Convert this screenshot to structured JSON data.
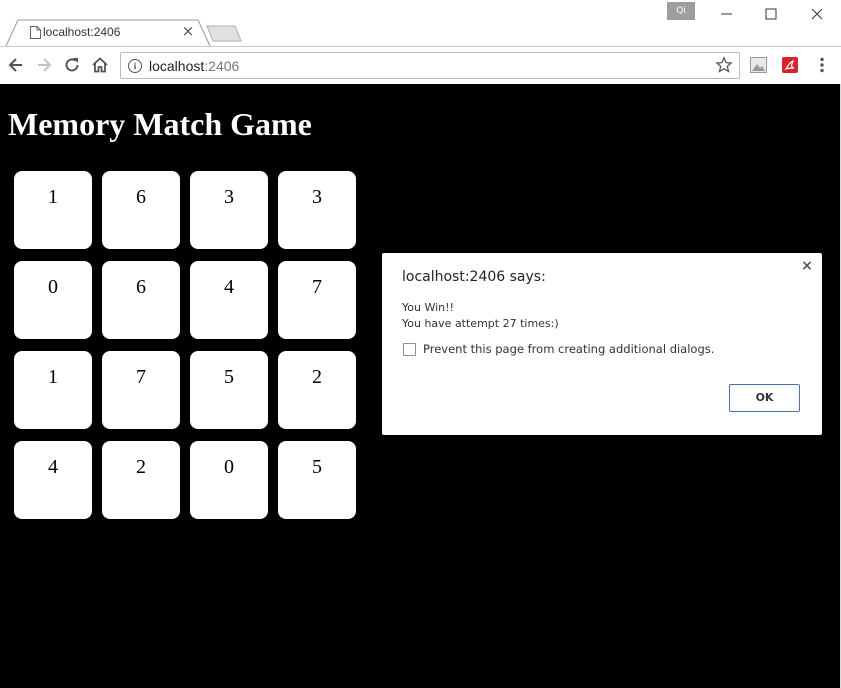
{
  "browser": {
    "tab": {
      "title": "localhost:2406"
    },
    "profile_badge": "Qi",
    "address": {
      "host": "localhost",
      "port": ":2406"
    }
  },
  "page": {
    "title": "Memory Match Game",
    "cards": [
      {
        "value": "1"
      },
      {
        "value": "6"
      },
      {
        "value": "3"
      },
      {
        "value": "3"
      },
      {
        "value": "0"
      },
      {
        "value": "6"
      },
      {
        "value": "4"
      },
      {
        "value": "7"
      },
      {
        "value": "1"
      },
      {
        "value": "7"
      },
      {
        "value": "5"
      },
      {
        "value": "2"
      },
      {
        "value": "4"
      },
      {
        "value": "2"
      },
      {
        "value": "0"
      },
      {
        "value": "5"
      }
    ]
  },
  "dialog": {
    "title": "localhost:2406 says:",
    "message_line1": "You Win!!",
    "message_line2": "You have attempt 27 times:)",
    "checkbox_label": "Prevent this page from creating additional dialogs.",
    "ok_label": "OK",
    "close_glyph": "×"
  },
  "colors": {
    "page_background": "#000000",
    "card_background": "#ffffff",
    "ok_border": "#4d6eaf"
  }
}
